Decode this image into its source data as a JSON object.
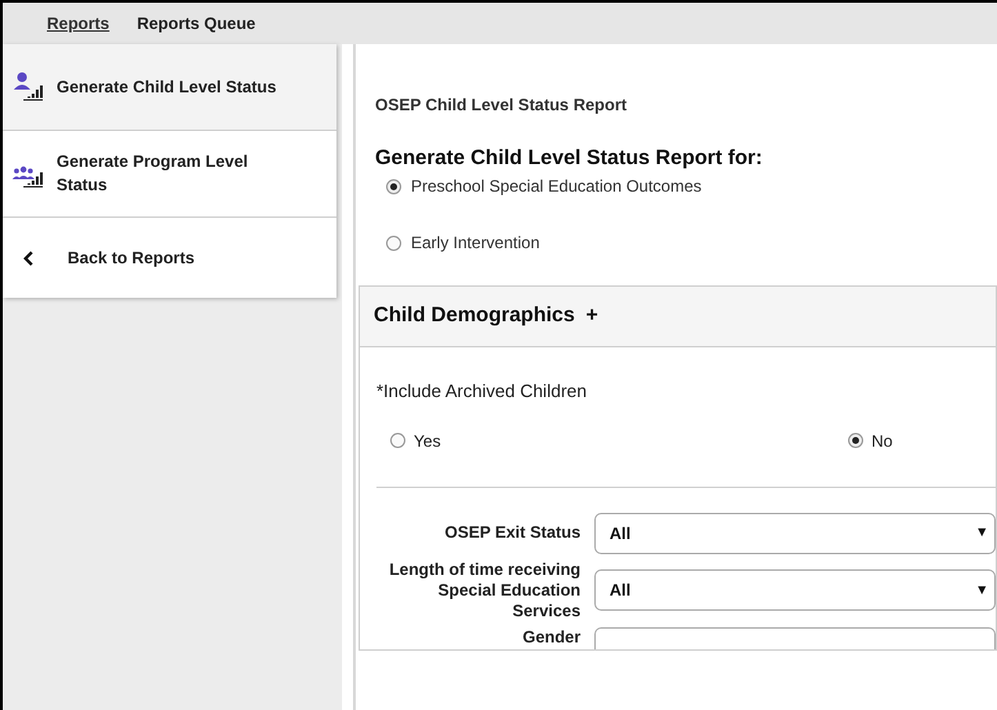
{
  "top_tabs": [
    {
      "label": "Reports",
      "selected": true
    },
    {
      "label": "Reports Queue",
      "selected": false
    }
  ],
  "sidebar": {
    "items": [
      {
        "kind": "child",
        "label": "Generate Child Level Status",
        "selected": true
      },
      {
        "kind": "program",
        "label": "Generate Program Level Status",
        "selected": false
      },
      {
        "kind": "back",
        "label": "Back to Reports",
        "selected": false
      }
    ]
  },
  "main": {
    "title": "OSEP Child Level Status Report",
    "heading": "Generate Child Level Status Report for:",
    "report_for": [
      {
        "label": "Preschool Special Education Outcomes",
        "selected": true
      },
      {
        "label": "Early Intervention",
        "selected": false
      }
    ],
    "section": {
      "title": "Child Demographics",
      "toggle": "+",
      "archived": {
        "label": "*Include Archived Children",
        "options": [
          {
            "label": "Yes",
            "selected": false
          },
          {
            "label": "No",
            "selected": true
          }
        ]
      },
      "filters": [
        {
          "label": "OSEP Exit Status",
          "value": "All",
          "arrow": "▼"
        },
        {
          "label": "Length of time receiving Special Education Services",
          "value": "All",
          "arrow": "▼"
        },
        {
          "label": "Gender"
        }
      ]
    }
  }
}
